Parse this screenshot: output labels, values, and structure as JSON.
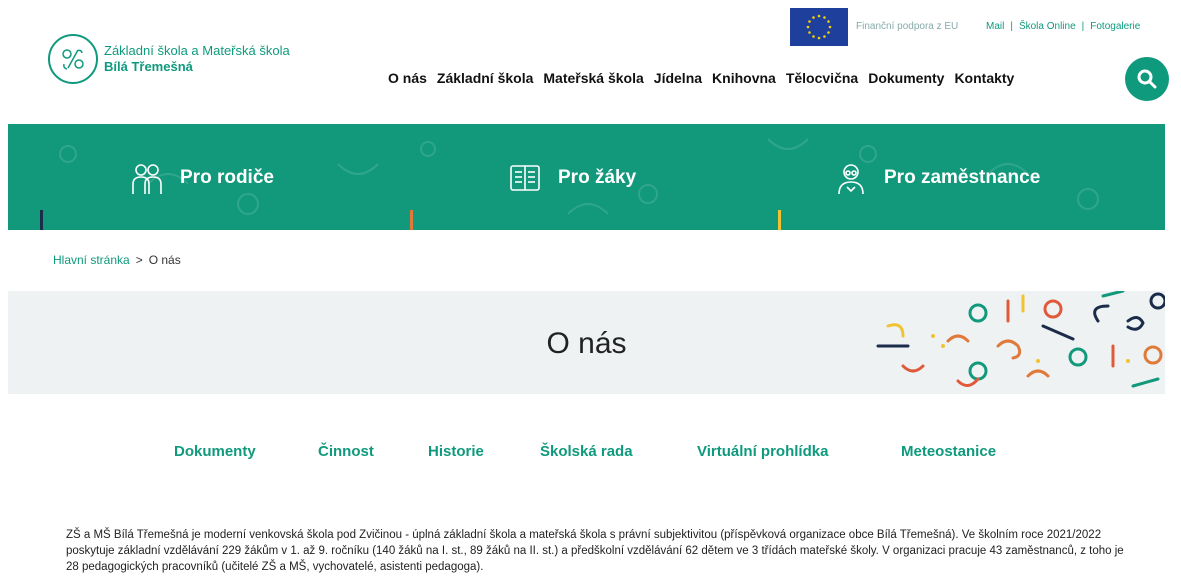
{
  "logo": {
    "line1": "Základní škola a Mateřská škola",
    "line2": "Bílá Třemešná"
  },
  "eu": {
    "text": "Finanční podpora z EU"
  },
  "toplinks": [
    "Mail",
    "Škola Online",
    "Fotogalerie"
  ],
  "mainnav": [
    "O nás",
    "Základní škola",
    "Mateřská škola",
    "Jídelna",
    "Knihovna",
    "Tělocvična",
    "Dokumenty",
    "Kontakty"
  ],
  "banner": {
    "items": [
      {
        "label": "Pro rodiče",
        "icon": "parents-icon"
      },
      {
        "label": "Pro žáky",
        "icon": "book-icon"
      },
      {
        "label": "Pro zaměstnance",
        "icon": "teacher-icon"
      }
    ],
    "accents": [
      "#1b2b4a",
      "#e07a3a",
      "#f2c230"
    ]
  },
  "breadcrumb": {
    "home": "Hlavní stránka",
    "separator": ">",
    "current": "O nás"
  },
  "page_title": "O nás",
  "subnav": [
    "Dokumenty",
    "Činnost",
    "Historie",
    "Školská rada",
    "Virtuální prohlídka",
    "Meteostanice"
  ],
  "intro": "ZŠ a MŠ Bílá Třemešná je moderní venkovská škola pod Zvičinou - úplná základní škola a mateřská škola s právní subjektivitou (příspěvková organizace obce Bílá Třemešná). Ve školním roce 2021/2022 poskytuje základní vzdělávání 229 žákům v 1. až 9. ročníku (140 žáků na I. st., 89 žáků na II. st.) a předškolní vzdělávání 62 dětem ve 3 třídách mateřské školy. V organizaci pracuje 43 zaměstnanců, z toho je 28 pedagogických pracovníků (učitelé ZŠ a MŠ, vychovatelé, asistenti pedagoga).",
  "colors": {
    "brand": "#12997c",
    "title_band": "#eef2f3"
  }
}
